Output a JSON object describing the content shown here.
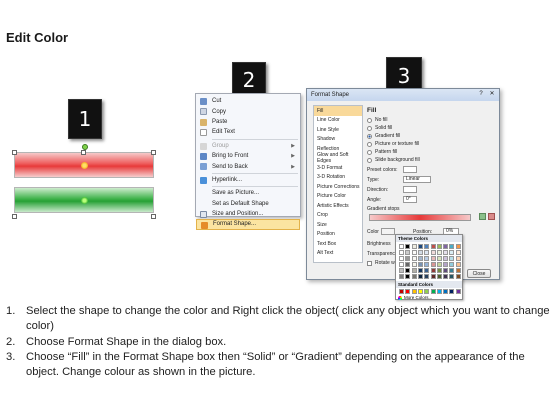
{
  "page": {
    "title": "Edit Color"
  },
  "steps": [
    "1",
    "2",
    "3"
  ],
  "context_menu": {
    "items": [
      {
        "label": "Cut",
        "icon": "scissors-icon",
        "disabled": false,
        "submenu": false
      },
      {
        "label": "Copy",
        "icon": "copy-icon",
        "disabled": false,
        "submenu": false
      },
      {
        "label": "Paste",
        "icon": "paste-icon",
        "disabled": false,
        "submenu": false
      },
      {
        "label": "Edit Text",
        "icon": "text-icon",
        "disabled": false,
        "submenu": false
      },
      {
        "label": "Group",
        "icon": "group-icon",
        "disabled": true,
        "submenu": true
      },
      {
        "label": "Bring to Front",
        "icon": "bring-front-icon",
        "disabled": false,
        "submenu": true
      },
      {
        "label": "Send to Back",
        "icon": "send-back-icon",
        "disabled": false,
        "submenu": true
      },
      {
        "label": "Hyperlink...",
        "icon": "hyperlink-icon",
        "disabled": false,
        "submenu": false
      },
      {
        "label": "Save as Picture...",
        "icon": "",
        "disabled": false,
        "submenu": false
      },
      {
        "label": "Set as Default Shape",
        "icon": "",
        "disabled": false,
        "submenu": false
      },
      {
        "label": "Size and Position...",
        "icon": "size-icon",
        "disabled": false,
        "submenu": false
      },
      {
        "label": "Format Shape...",
        "icon": "format-shape-icon",
        "disabled": false,
        "submenu": false,
        "highlighted": true
      }
    ]
  },
  "format_dialog": {
    "title": "Format Shape",
    "categories": [
      "Fill",
      "Line Color",
      "Line Style",
      "Shadow",
      "Reflection",
      "Glow and Soft Edges",
      "3-D Format",
      "3-D Rotation",
      "Picture Corrections",
      "Picture Color",
      "Artistic Effects",
      "Crop",
      "Size",
      "Position",
      "Text Box",
      "Alt Text"
    ],
    "selected_category": "Fill",
    "fill_heading": "Fill",
    "fill_options": [
      "No fill",
      "Solid fill",
      "Gradient fill",
      "Picture or texture fill",
      "Pattern fill",
      "Slide background fill"
    ],
    "selected_fill": "Gradient fill",
    "preset_colors_label": "Preset colors:",
    "type_label": "Type:",
    "type_value": "Linear",
    "direction_label": "Direction:",
    "angle_label": "Angle:",
    "angle_value": "0°",
    "gradient_stops_label": "Gradient stops",
    "color_label": "Color",
    "position_label": "Position:",
    "position_value": "0%",
    "brightness_label": "Brightness",
    "transparency_label": "Transparency",
    "rotate_label": "Rotate with shape",
    "close_label": "Close"
  },
  "color_palette": {
    "theme_heading": "Theme Colors",
    "standard_heading": "Standard Colors",
    "more_colors": "More Colors...",
    "theme_colors": [
      "#ffffff",
      "#000000",
      "#eeece1",
      "#1f497d",
      "#4f81bd",
      "#c0504d",
      "#9bbb59",
      "#8064a2",
      "#4bacc6",
      "#f79646"
    ],
    "standard_colors": [
      "#c00000",
      "#ff0000",
      "#ffc000",
      "#ffff00",
      "#92d050",
      "#00b050",
      "#00b0f0",
      "#0070c0",
      "#002060",
      "#7030a0"
    ]
  },
  "instructions": [
    {
      "num": "1.",
      "text": "Select the shape to change the color and Right click the object( click any object which you want to change color)"
    },
    {
      "num": "2.",
      "text": "Choose Format Shape in the dialog box."
    },
    {
      "num": "3.",
      "text": "Choose “Fill” in the Format Shape box then “Solid” or “Gradient” depending on the appearance of the object. Change colour as shown in the picture."
    }
  ]
}
